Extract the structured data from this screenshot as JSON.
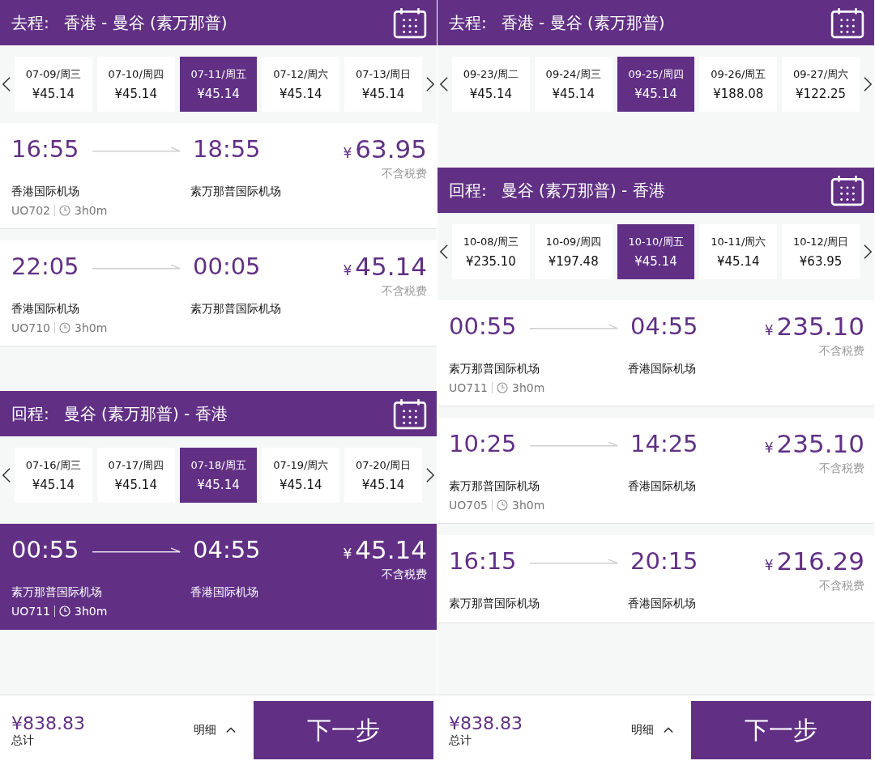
{
  "panels": [
    {
      "legs": [
        {
          "label": "去程:",
          "route": "香港 - 曼谷 (素万那普)",
          "dates": [
            {
              "date": "07-09/周三",
              "price": "¥45.14",
              "selected": false
            },
            {
              "date": "07-10/周四",
              "price": "¥45.14",
              "selected": false
            },
            {
              "date": "07-11/周五",
              "price": "¥45.14",
              "selected": true
            },
            {
              "date": "07-12/周六",
              "price": "¥45.14",
              "selected": false
            },
            {
              "date": "07-13/周日",
              "price": "¥45.14",
              "selected": false
            }
          ],
          "flights": [
            {
              "depart": "16:55",
              "arrive": "18:55",
              "currency": "¥",
              "amount": "63.95",
              "note": "不含税费",
              "from": "香港国际机场",
              "to": "素万那普国际机场",
              "flight_no": "UO702",
              "duration": "3h0m",
              "selected": false
            },
            {
              "depart": "22:05",
              "arrive": "00:05",
              "currency": "¥",
              "amount": "45.14",
              "note": "不含税费",
              "from": "香港国际机场",
              "to": "素万那普国际机场",
              "flight_no": "UO710",
              "duration": "3h0m",
              "selected": false
            }
          ]
        },
        {
          "label": "回程:",
          "route": "曼谷 (素万那普) - 香港",
          "dates": [
            {
              "date": "07-16/周三",
              "price": "¥45.14",
              "selected": false
            },
            {
              "date": "07-17/周四",
              "price": "¥45.14",
              "selected": false
            },
            {
              "date": "07-18/周五",
              "price": "¥45.14",
              "selected": true
            },
            {
              "date": "07-19/周六",
              "price": "¥45.14",
              "selected": false
            },
            {
              "date": "07-20/周日",
              "price": "¥45.14",
              "selected": false
            }
          ],
          "flights": [
            {
              "depart": "00:55",
              "arrive": "04:55",
              "currency": "¥",
              "amount": "45.14",
              "note": "不含税费",
              "from": "素万那普国际机场",
              "to": "香港国际机场",
              "flight_no": "UO711",
              "duration": "3h0m",
              "selected": true
            }
          ]
        }
      ],
      "footer": {
        "total": "¥838.83",
        "total_label": "总计",
        "details": "明细",
        "next": "下一步"
      }
    },
    {
      "legs": [
        {
          "label": "去程:",
          "route": "香港 - 曼谷 (素万那普)",
          "dates": [
            {
              "date": "09-23/周二",
              "price": "¥45.14",
              "selected": false
            },
            {
              "date": "09-24/周三",
              "price": "¥45.14",
              "selected": false
            },
            {
              "date": "09-25/周四",
              "price": "¥45.14",
              "selected": true
            },
            {
              "date": "09-26/周五",
              "price": "¥188.08",
              "selected": false
            },
            {
              "date": "09-27/周六",
              "price": "¥122.25",
              "selected": false
            }
          ]
        },
        {
          "label": "回程:",
          "route": "曼谷 (素万那普) - 香港",
          "dates": [
            {
              "date": "10-08/周三",
              "price": "¥235.10",
              "selected": false
            },
            {
              "date": "10-09/周四",
              "price": "¥197.48",
              "selected": false
            },
            {
              "date": "10-10/周五",
              "price": "¥45.14",
              "selected": true
            },
            {
              "date": "10-11/周六",
              "price": "¥45.14",
              "selected": false
            },
            {
              "date": "10-12/周日",
              "price": "¥63.95",
              "selected": false
            }
          ],
          "flights": [
            {
              "depart": "00:55",
              "arrive": "04:55",
              "currency": "¥",
              "amount": "235.10",
              "note": "不含税费",
              "from": "素万那普国际机场",
              "to": "香港国际机场",
              "flight_no": "UO711",
              "duration": "3h0m",
              "selected": false
            },
            {
              "depart": "10:25",
              "arrive": "14:25",
              "currency": "¥",
              "amount": "235.10",
              "note": "不含税费",
              "from": "素万那普国际机场",
              "to": "香港国际机场",
              "flight_no": "UO705",
              "duration": "3h0m",
              "selected": false
            },
            {
              "depart": "16:15",
              "arrive": "20:15",
              "currency": "¥",
              "amount": "216.29",
              "note": "不含税费",
              "from": "素万那普国际机场",
              "to": "香港国际机场",
              "selected": false
            }
          ]
        }
      ],
      "footer": {
        "total": "¥838.83",
        "total_label": "总计",
        "details": "明细",
        "next": "下一步"
      }
    }
  ]
}
